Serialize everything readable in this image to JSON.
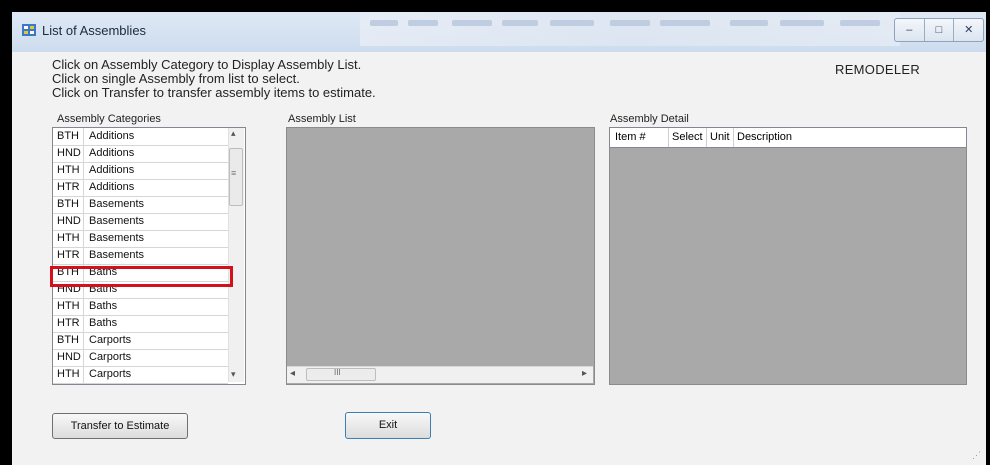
{
  "window": {
    "title": "List of Assemblies",
    "controls": [
      "–",
      "□",
      "✕"
    ],
    "blurred_toolbar": [
      "Save",
      "Quit",
      "Add/Edit",
      "Reorder",
      "Delete",
      "Edit Item",
      "Print",
      "Insert",
      "Create",
      "Change",
      "Update",
      "Remove"
    ]
  },
  "instructions": [
    "Click on Assembly Category to Display Assembly List.",
    "Click on single Assembly from list to select.",
    "Click on Transfer to transfer assembly items to estimate."
  ],
  "brand": "REMODELER",
  "categories": {
    "label": "Assembly Categories",
    "rows": [
      {
        "code": "BTH",
        "name": "Additions"
      },
      {
        "code": "HND",
        "name": "Additions"
      },
      {
        "code": "HTH",
        "name": "Additions"
      },
      {
        "code": "HTR",
        "name": "Additions"
      },
      {
        "code": "BTH",
        "name": "Basements"
      },
      {
        "code": "HND",
        "name": "Basements"
      },
      {
        "code": "HTH",
        "name": "Basements"
      },
      {
        "code": "HTR",
        "name": "Basements"
      },
      {
        "code": "BTH",
        "name": "Baths"
      },
      {
        "code": "HND",
        "name": "Baths"
      },
      {
        "code": "HTH",
        "name": "Baths"
      },
      {
        "code": "HTR",
        "name": "Baths"
      },
      {
        "code": "BTH",
        "name": "Carports"
      },
      {
        "code": "HND",
        "name": "Carports"
      },
      {
        "code": "HTH",
        "name": "Carports"
      }
    ],
    "highlighted_index": 8
  },
  "assembly_list": {
    "label": "Assembly List",
    "hscroll_glyph": "III",
    "left_arrow": "◂",
    "right_arrow": "▸"
  },
  "assembly_detail": {
    "label": "Assembly Detail",
    "columns": [
      "Item #",
      "Select",
      "Unit",
      "Description"
    ]
  },
  "scroll": {
    "up": "▴",
    "down": "▾",
    "grip": "≡"
  },
  "buttons": {
    "transfer": "Transfer to Estimate",
    "exit": "Exit"
  },
  "colors": {
    "highlight": "#d4101a",
    "panel": "#a9a9a9"
  }
}
